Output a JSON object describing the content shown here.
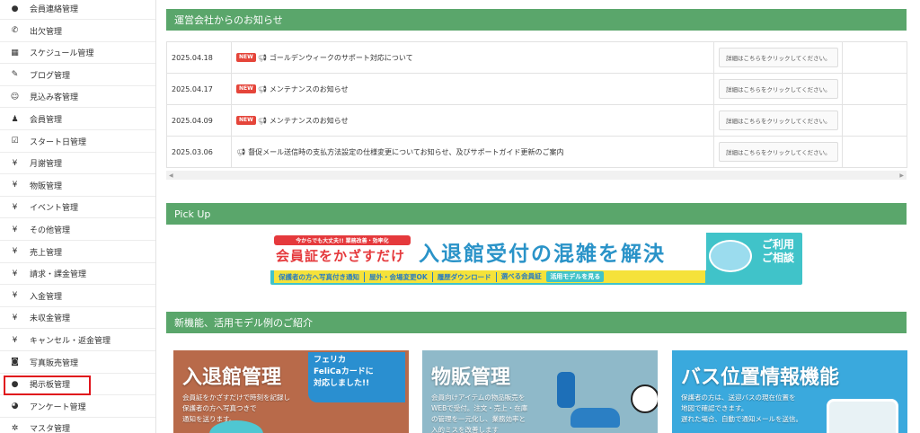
{
  "sidebar": {
    "items": [
      {
        "icon": "chat-bubble-icon",
        "glyph": "●",
        "label": "会員連絡管理"
      },
      {
        "icon": "phone-icon",
        "glyph": "✆",
        "label": "出欠管理"
      },
      {
        "icon": "calendar-icon",
        "glyph": "▦",
        "label": "スケジュール管理"
      },
      {
        "icon": "pencil-icon",
        "glyph": "✎",
        "label": "ブログ管理"
      },
      {
        "icon": "smiley-icon",
        "glyph": "☺",
        "label": "見込み客管理"
      },
      {
        "icon": "user-icon",
        "glyph": "♟",
        "label": "会員管理"
      },
      {
        "icon": "checkbox-icon",
        "glyph": "☑",
        "label": "スタート日管理"
      },
      {
        "icon": "yen-icon",
        "glyph": "¥",
        "label": "月謝管理"
      },
      {
        "icon": "yen-icon",
        "glyph": "¥",
        "label": "物販管理"
      },
      {
        "icon": "yen-icon",
        "glyph": "¥",
        "label": "イベント管理"
      },
      {
        "icon": "yen-icon",
        "glyph": "¥",
        "label": "その他管理"
      },
      {
        "icon": "yen-icon",
        "glyph": "¥",
        "label": "売上管理"
      },
      {
        "icon": "yen-icon",
        "glyph": "¥",
        "label": "請求・課金管理"
      },
      {
        "icon": "yen-icon",
        "glyph": "¥",
        "label": "入金管理"
      },
      {
        "icon": "yen-icon",
        "glyph": "¥",
        "label": "未収金管理"
      },
      {
        "icon": "yen-icon",
        "glyph": "¥",
        "label": "キャンセル・返金管理"
      },
      {
        "icon": "camera-icon",
        "glyph": "◙",
        "label": "写真販売管理"
      },
      {
        "icon": "chat-bubble-icon",
        "glyph": "●",
        "label": "掲示板管理"
      },
      {
        "icon": "dashboard-icon",
        "glyph": "◕",
        "label": "アンケート管理"
      },
      {
        "icon": "gear-icon",
        "glyph": "✲",
        "label": "マスタ管理"
      }
    ]
  },
  "notices": {
    "heading": "運営会社からのお知らせ",
    "rows": [
      {
        "date": "2025.04.18",
        "is_new": true,
        "new_label": "NEW",
        "title": "ゴールデンウィークのサポート対応について",
        "detail": "詳細はこちらをクリックしてください。"
      },
      {
        "date": "2025.04.17",
        "is_new": true,
        "new_label": "NEW",
        "title": "メンテナンスのお知らせ",
        "detail": "詳細はこちらをクリックしてください。"
      },
      {
        "date": "2025.04.09",
        "is_new": true,
        "new_label": "NEW",
        "title": "メンテナンスのお知らせ",
        "detail": "詳細はこちらをクリックしてください。"
      },
      {
        "date": "2025.03.06",
        "is_new": false,
        "new_label": "",
        "title": "督促メール送信時の支払方法設定の仕様変更についてお知らせ、及びサポートガイド更新のご案内",
        "detail": "詳細はこちらをクリックしてください。"
      }
    ]
  },
  "pickup": {
    "heading": "Pick Up",
    "banner": {
      "tag": "今からでも大丈夫!! 業務改善・効率化",
      "lead": "会員証をかざすだけ",
      "title": "入退館受付の混雑を解決",
      "cta_line1": "ご利用",
      "cta_line2": "ご相談",
      "features": [
        "保護者の方へ写真付き通知",
        "屋外・会場変更OK",
        "履歴ダウンロード",
        "選べる会員証"
      ],
      "model_link": "活用モデルを見る"
    }
  },
  "features": {
    "heading": "新機能、活用モデル例のご紹介",
    "cards": [
      {
        "title": "入退館管理",
        "badge": "フェリカ\nFeliCaカードに\n対応しました!!",
        "desc": "会員証をかざすだけで時刻を記録し\n保護者の方へ写真つきで\n通知を送ります。",
        "bg": "#b86a4a"
      },
      {
        "title": "物販管理",
        "badge": "",
        "desc": "会員向けアイテムの物品販売を\nWEBで受付。注文・売上・在庫\nの管理を一元化し、業務効率と\n入的ミスを改善します",
        "bg": "#8fb9c9"
      },
      {
        "title": "バス位置情報機能",
        "badge": "",
        "desc": "保護者の方は、送迎バスの現在位置を\n地図で確認できます。\n遅れた場合、自動で通知メールを送信。",
        "bg": "#3aa9dd"
      }
    ]
  },
  "colors": {
    "header_green": "#5aa66b",
    "new_badge": "#e5453a",
    "highlight": "#e0141c"
  }
}
